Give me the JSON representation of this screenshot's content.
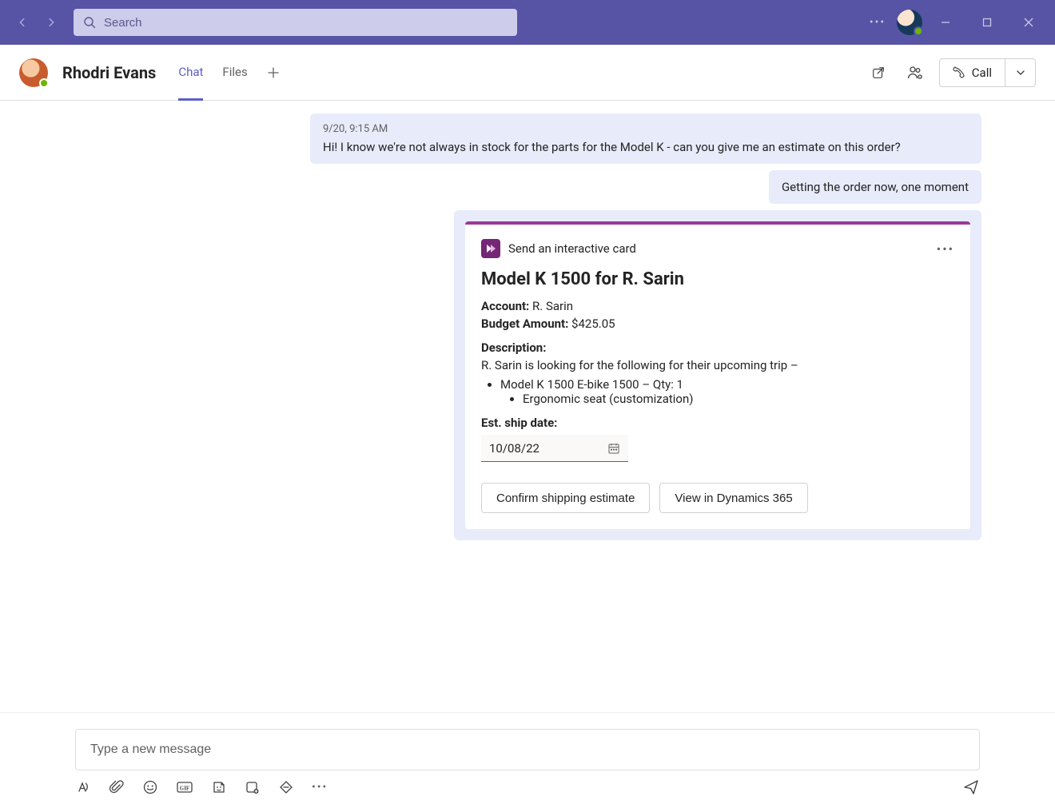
{
  "titlebar": {
    "search_placeholder": "Search"
  },
  "chat_header": {
    "name": "Rhodri Evans",
    "tabs": {
      "chat": "Chat",
      "files": "Files"
    },
    "call_label": "Call"
  },
  "messages": {
    "incoming": {
      "timestamp": "9/20, 9:15 AM",
      "text": "Hi! I know we're not always in stock for the parts for the Model K - can you give me an estimate on this order?"
    },
    "reply": {
      "text": "Getting the order now, one moment"
    }
  },
  "card": {
    "app_label": "Send an interactive card",
    "title": "Model K 1500 for R. Sarin",
    "account_label": "Account:",
    "account_value": "R. Sarin",
    "budget_label": "Budget Amount:",
    "budget_value": "$425.05",
    "description_label": "Description:",
    "description_text": "R. Sarin is looking for the following for their upcoming trip –",
    "item_1": "Model K 1500 E-bike 1500 – Qty: 1",
    "item_1a": "Ergonomic seat (customization)",
    "shipdate_label": "Est. ship date:",
    "shipdate_value": "10/08/22",
    "btn_confirm": "Confirm shipping estimate",
    "btn_view": "View in Dynamics 365"
  },
  "compose": {
    "placeholder": "Type a new message"
  }
}
